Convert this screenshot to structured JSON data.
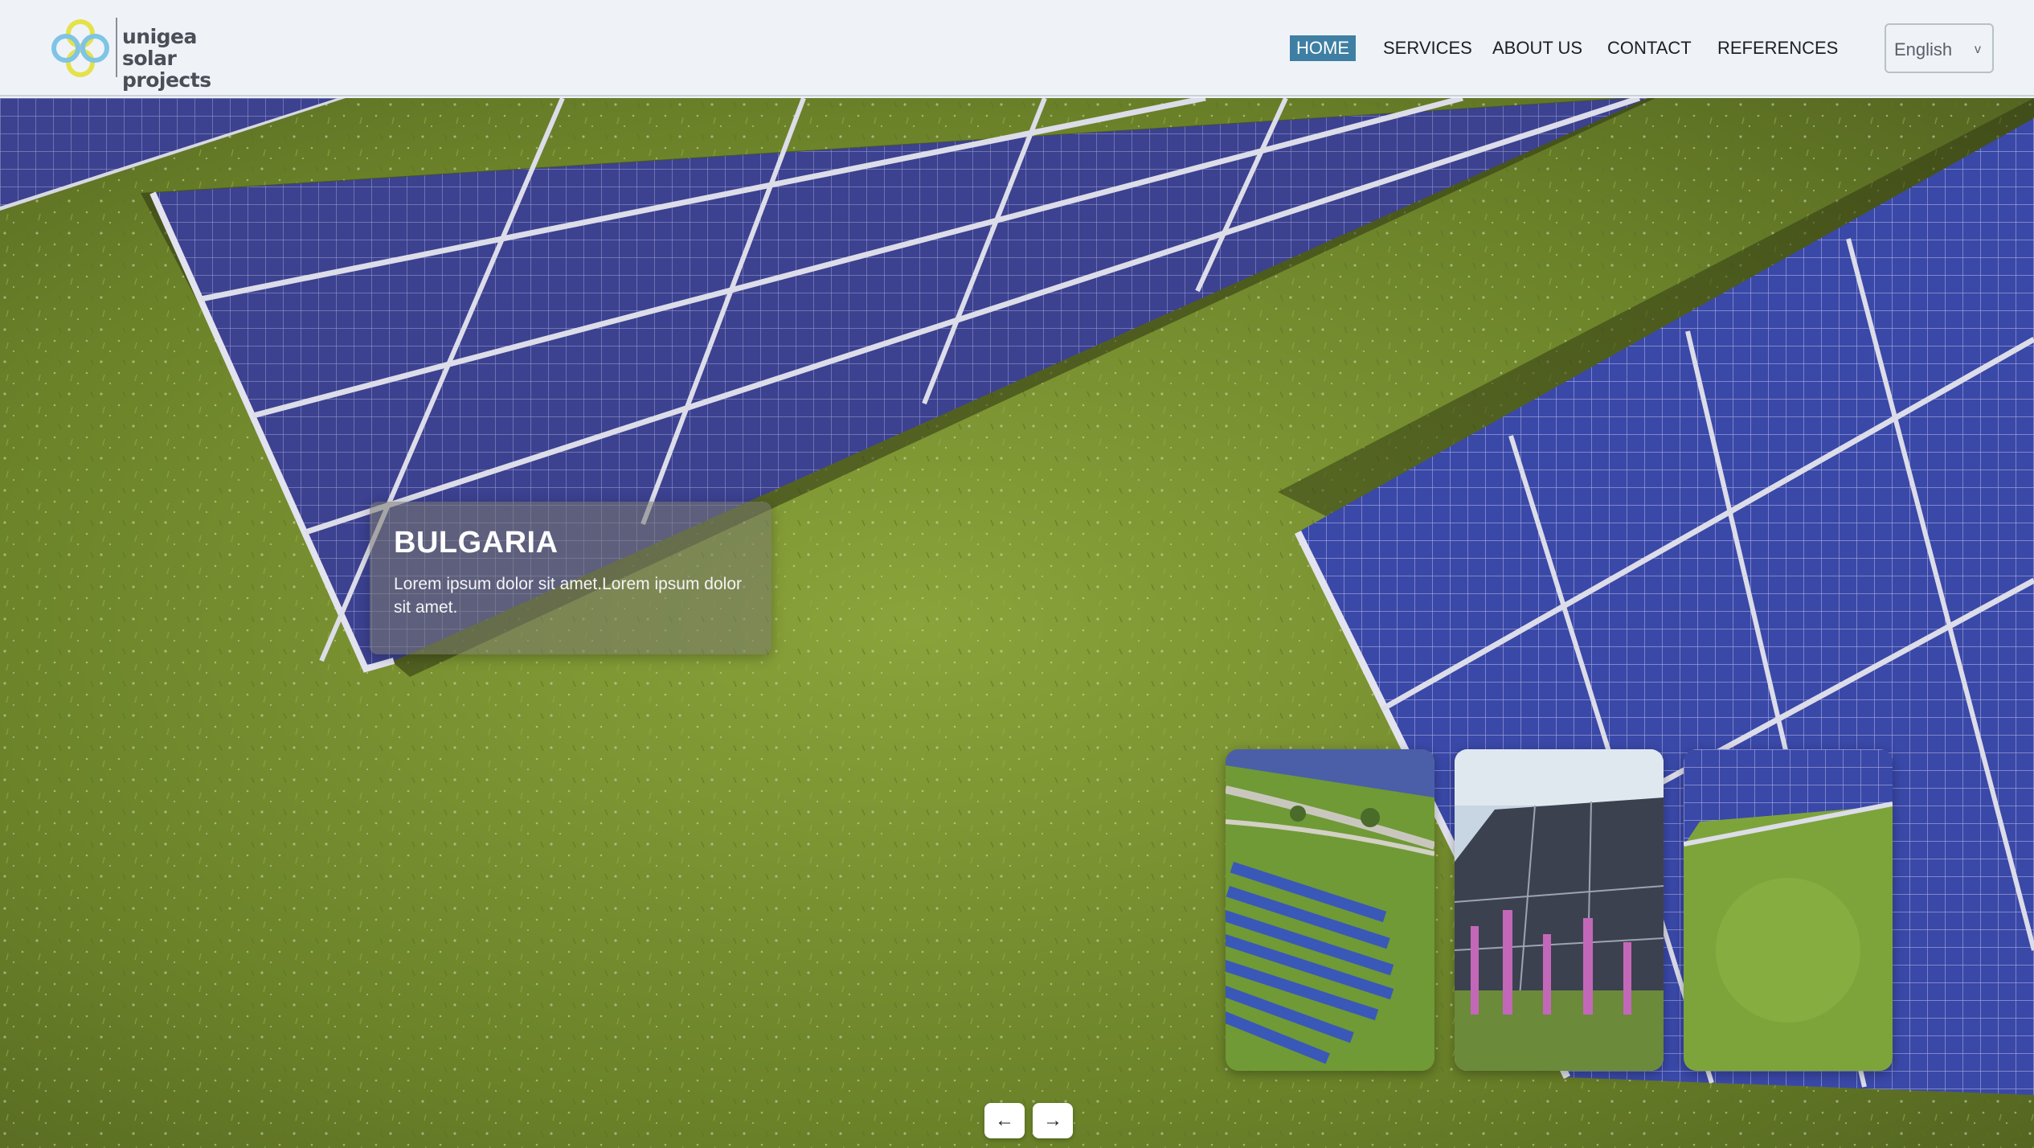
{
  "brand": {
    "name_line1": "unigea solar",
    "name_line2": "projects",
    "logo_icon": "four-ring-clover-logo-icon"
  },
  "nav": {
    "items": [
      {
        "label": "HOME",
        "active": true
      },
      {
        "label": "SERVICES",
        "active": false
      },
      {
        "label": "ABOUT US",
        "active": false
      },
      {
        "label": "CONTACT",
        "active": false
      },
      {
        "label": "REFERENCES",
        "active": false
      }
    ],
    "active_color": "#3e7fa3"
  },
  "language": {
    "selected": "English",
    "chevron": "v"
  },
  "hero": {
    "slide_title": "BULGARIA",
    "slide_text": "Lorem ipsum dolor sit amet.Lorem ipsum dolor sit amet.",
    "thumbnails": [
      {
        "name": "aerial-solar-farm-thumbnail"
      },
      {
        "name": "solar-panels-flowers-thumbnail"
      },
      {
        "name": "solar-panels-grass-thumbnail"
      }
    ],
    "prev_icon": "arrow-left-icon",
    "next_icon": "arrow-right-icon"
  },
  "colors": {
    "header_bg": "#eff3f8",
    "grass": "#6f8a2e",
    "panel": "#3b3f8e"
  }
}
